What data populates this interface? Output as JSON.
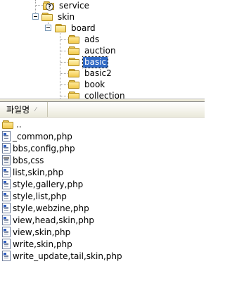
{
  "tree": {
    "items": [
      {
        "label": "service",
        "depth": 1,
        "icon": "help-folder-icon",
        "expanded": false,
        "selected": false
      },
      {
        "label": "skin",
        "depth": 1,
        "icon": "open-folder-icon",
        "expanded": true,
        "selected": false
      },
      {
        "label": "board",
        "depth": 2,
        "icon": "open-folder-icon",
        "expanded": true,
        "selected": false
      },
      {
        "label": "ads",
        "depth": 3,
        "icon": "folder-icon",
        "expanded": false,
        "selected": false
      },
      {
        "label": "auction",
        "depth": 3,
        "icon": "folder-icon",
        "expanded": false,
        "selected": false
      },
      {
        "label": "basic",
        "depth": 3,
        "icon": "open-folder-icon",
        "expanded": false,
        "selected": true
      },
      {
        "label": "basic2",
        "depth": 3,
        "icon": "folder-icon",
        "expanded": false,
        "selected": false
      },
      {
        "label": "book",
        "depth": 3,
        "icon": "folder-icon",
        "expanded": false,
        "selected": false
      },
      {
        "label": "collection",
        "depth": 3,
        "icon": "folder-icon",
        "expanded": false,
        "selected": false
      }
    ]
  },
  "list": {
    "header": {
      "name_label": "파일명",
      "sort_indicator": "⁄"
    },
    "files": [
      {
        "name": "..",
        "icon": "parent-folder-icon"
      },
      {
        "name": "_common,php",
        "icon": "php-file-icon"
      },
      {
        "name": "bbs,config,php",
        "icon": "php-file-icon"
      },
      {
        "name": "bbs,css",
        "icon": "css-file-icon"
      },
      {
        "name": "list,skin,php",
        "icon": "php-file-icon"
      },
      {
        "name": "style,gallery,php",
        "icon": "php-file-icon"
      },
      {
        "name": "style,list,php",
        "icon": "php-file-icon"
      },
      {
        "name": "style,webzine,php",
        "icon": "php-file-icon"
      },
      {
        "name": "view,head,skin,php",
        "icon": "php-file-icon"
      },
      {
        "name": "view,skin,php",
        "icon": "php-file-icon"
      },
      {
        "name": "write,skin,php",
        "icon": "php-file-icon"
      },
      {
        "name": "write_update,tail,skin,php",
        "icon": "php-file-icon"
      }
    ]
  },
  "colors": {
    "selection": "#316ac5",
    "header_bg": "#ebeadb"
  }
}
